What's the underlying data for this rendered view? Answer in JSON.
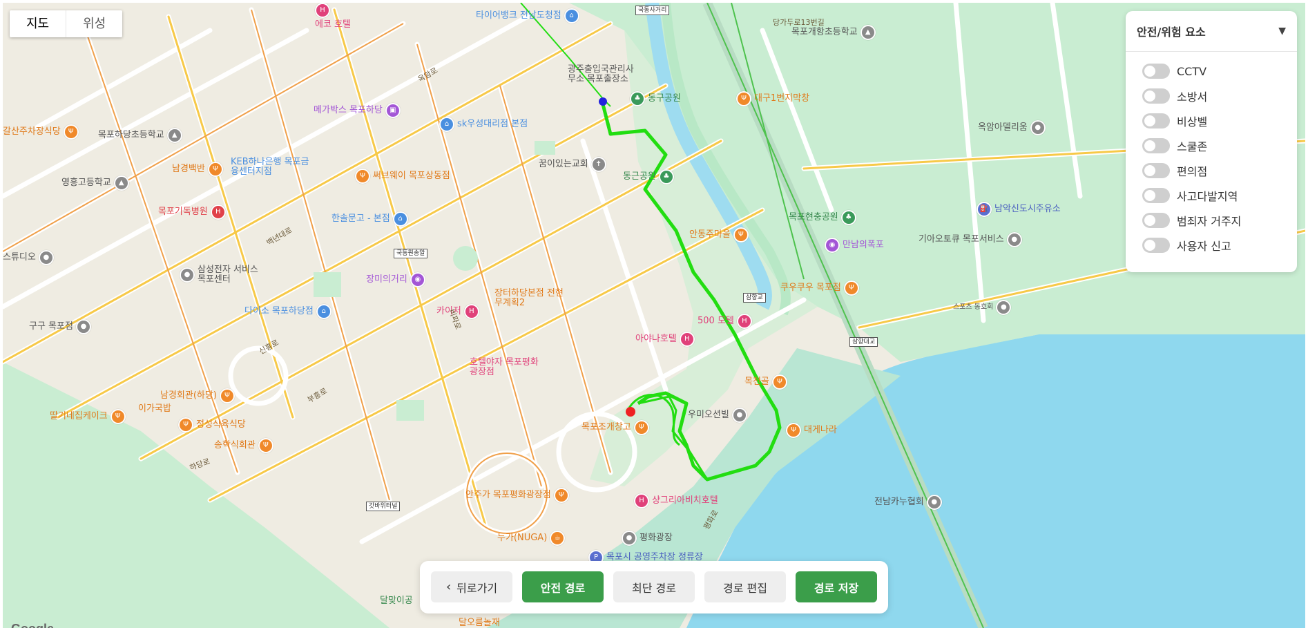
{
  "map_type": {
    "map_label": "지도",
    "satellite_label": "위성"
  },
  "safety_panel": {
    "title": "안전/위험 요소",
    "toggle_arrow": "▼",
    "items": [
      {
        "label": "CCTV",
        "on": false
      },
      {
        "label": "소방서",
        "on": false
      },
      {
        "label": "비상벨",
        "on": false
      },
      {
        "label": "스쿨존",
        "on": false
      },
      {
        "label": "편의점",
        "on": false
      },
      {
        "label": "사고다발지역",
        "on": false
      },
      {
        "label": "범죄자 거주지",
        "on": false
      },
      {
        "label": "사용자 신고",
        "on": false
      }
    ]
  },
  "toolbar": {
    "back_label": "뒤로가기",
    "safe_route_label": "안전 경로",
    "shortest_route_label": "최단 경로",
    "edit_route_label": "경로 편집",
    "save_route_label": "경로 저장"
  },
  "map": {
    "attribution": "Google",
    "route_colors": {
      "safe": "#22dd11",
      "shortest": "#11cc11",
      "start": "#2222dd",
      "end": "#ee2222"
    },
    "pois": [
      {
        "name": "에코 호텔",
        "color": "#e0417a",
        "icon": "hotel-icon"
      },
      {
        "name": "타이어뱅크 전남도청점",
        "color": "#4a8fe0",
        "icon": "shop-icon"
      },
      {
        "name": "당가두로13번길",
        "color": "#777",
        "icon": "street-label"
      },
      {
        "name": "목포개항초등학교",
        "color": "#555",
        "icon": "school-icon"
      },
      {
        "name": "광주출입국관리사무소 목포출장소",
        "color": "#555",
        "icon": "government-icon"
      },
      {
        "name": "동구공원",
        "color": "#3a8a50",
        "icon": "park-icon"
      },
      {
        "name": "대구1번지막창",
        "color": "#e07a1a",
        "icon": "restaurant-icon"
      },
      {
        "name": "메가박스 목포하당",
        "color": "#a356d6",
        "icon": "cinema-icon"
      },
      {
        "name": "sk우성대리점 본점",
        "color": "#4a8fe0",
        "icon": "shop-icon"
      },
      {
        "name": "목포하당초등학교",
        "color": "#555",
        "icon": "school-icon"
      },
      {
        "name": "옥암아델리움",
        "color": "#555",
        "icon": "building-icon"
      },
      {
        "name": "갈산주차장식당",
        "color": "#e07a1a",
        "icon": "restaurant-icon"
      },
      {
        "name": "남경백반",
        "color": "#e07a1a",
        "icon": "restaurant-icon"
      },
      {
        "name": "KEB하나은행 목포금융센터지점",
        "color": "#4a8fe0",
        "icon": "bank-icon"
      },
      {
        "name": "써브웨이 목포상동점",
        "color": "#e07a1a",
        "icon": "restaurant-icon"
      },
      {
        "name": "꿈이있는교회",
        "color": "#555",
        "icon": "church-icon"
      },
      {
        "name": "동근공원",
        "color": "#3a8a50",
        "icon": "park-icon"
      },
      {
        "name": "영흥고등학교",
        "color": "#555",
        "icon": "school-icon"
      },
      {
        "name": "목포기독병원",
        "color": "#e0414a",
        "icon": "hospital-icon"
      },
      {
        "name": "한솔문고 - 본점",
        "color": "#4a8fe0",
        "icon": "shop-icon"
      },
      {
        "name": "목포현충공원",
        "color": "#3a8a50",
        "icon": "park-icon"
      },
      {
        "name": "남악신도시주유소",
        "color": "#4a60c0",
        "icon": "gas-icon"
      },
      {
        "name": "안동주마을",
        "color": "#e07a1a",
        "icon": "restaurant-icon"
      },
      {
        "name": "만남의폭포",
        "color": "#a356d6",
        "icon": "attraction-icon"
      },
      {
        "name": "기아오토큐 목포서비스",
        "color": "#555",
        "icon": "car-icon"
      },
      {
        "name": "스튜디오",
        "color": "#555",
        "icon": "shop-icon"
      },
      {
        "name": "삼성전자 서비스 목포센터",
        "color": "#555",
        "icon": "service-icon"
      },
      {
        "name": "장미의거리",
        "color": "#a356d6",
        "icon": "attraction-icon"
      },
      {
        "name": "쿠우쿠우 목포점",
        "color": "#e07a1a",
        "icon": "restaurant-icon"
      },
      {
        "name": "장터하당본점 전현무계획2",
        "color": "#e07a1a",
        "icon": "restaurant-icon"
      },
      {
        "name": "다이소 목포하당점",
        "color": "#4a8fe0",
        "icon": "shop-icon"
      },
      {
        "name": "구구 목포점",
        "color": "#555",
        "icon": "shop-icon"
      },
      {
        "name": "카이저",
        "color": "#e0417a",
        "icon": "hotel-icon"
      },
      {
        "name": "500 모텔",
        "color": "#e0417a",
        "icon": "hotel-icon"
      },
      {
        "name": "스포츠 동호회",
        "color": "#555",
        "icon": "sports-icon"
      },
      {
        "name": "아야나호텔",
        "color": "#e0417a",
        "icon": "hotel-icon"
      },
      {
        "name": "호텔야자 목포평화광장점",
        "color": "#e0417a",
        "icon": "hotel-icon"
      },
      {
        "name": "목천골",
        "color": "#e07a1a",
        "icon": "restaurant-icon"
      },
      {
        "name": "남경회관(하당)",
        "color": "#e07a1a",
        "icon": "restaurant-icon"
      },
      {
        "name": "이가국밥",
        "color": "#e07a1a",
        "icon": "restaurant-icon"
      },
      {
        "name": "딸기네집케이크",
        "color": "#e07a1a",
        "icon": "cafe-icon"
      },
      {
        "name": "정성식육식당",
        "color": "#e07a1a",
        "icon": "restaurant-icon"
      },
      {
        "name": "우미오션빌",
        "color": "#555",
        "icon": "building-icon"
      },
      {
        "name": "목포조개창고",
        "color": "#e07a1a",
        "icon": "restaurant-icon"
      },
      {
        "name": "대게나라",
        "color": "#e07a1a",
        "icon": "restaurant-icon"
      },
      {
        "name": "송학식회관",
        "color": "#e07a1a",
        "icon": "restaurant-icon"
      },
      {
        "name": "안주가 목포평화광장점",
        "color": "#e07a1a",
        "icon": "bar-icon"
      },
      {
        "name": "샹그리아비치호텔",
        "color": "#e0417a",
        "icon": "hotel-icon"
      },
      {
        "name": "전남카누협회",
        "color": "#555",
        "icon": "sports-icon"
      },
      {
        "name": "누가(NUGA)",
        "color": "#e07a1a",
        "icon": "cafe-icon"
      },
      {
        "name": "평화광장",
        "color": "#555",
        "icon": "place-icon"
      },
      {
        "name": "목포시 공영주차장 정류장",
        "color": "#4a60c0",
        "icon": "parking-icon"
      },
      {
        "name": "달맞이공",
        "color": "#3a8a50",
        "icon": "park-icon"
      },
      {
        "name": "달오름놀재",
        "color": "#e07a1a",
        "icon": "restaurant-icon"
      }
    ],
    "road_signs": [
      "국동사거리",
      "국동원송알",
      "삼향교",
      "삼향대교",
      "갓바위터널"
    ],
    "streets": [
      "백년대로",
      "옥암로",
      "하당로",
      "평화로",
      "부흥로",
      "신흥로",
      "비파로"
    ]
  }
}
